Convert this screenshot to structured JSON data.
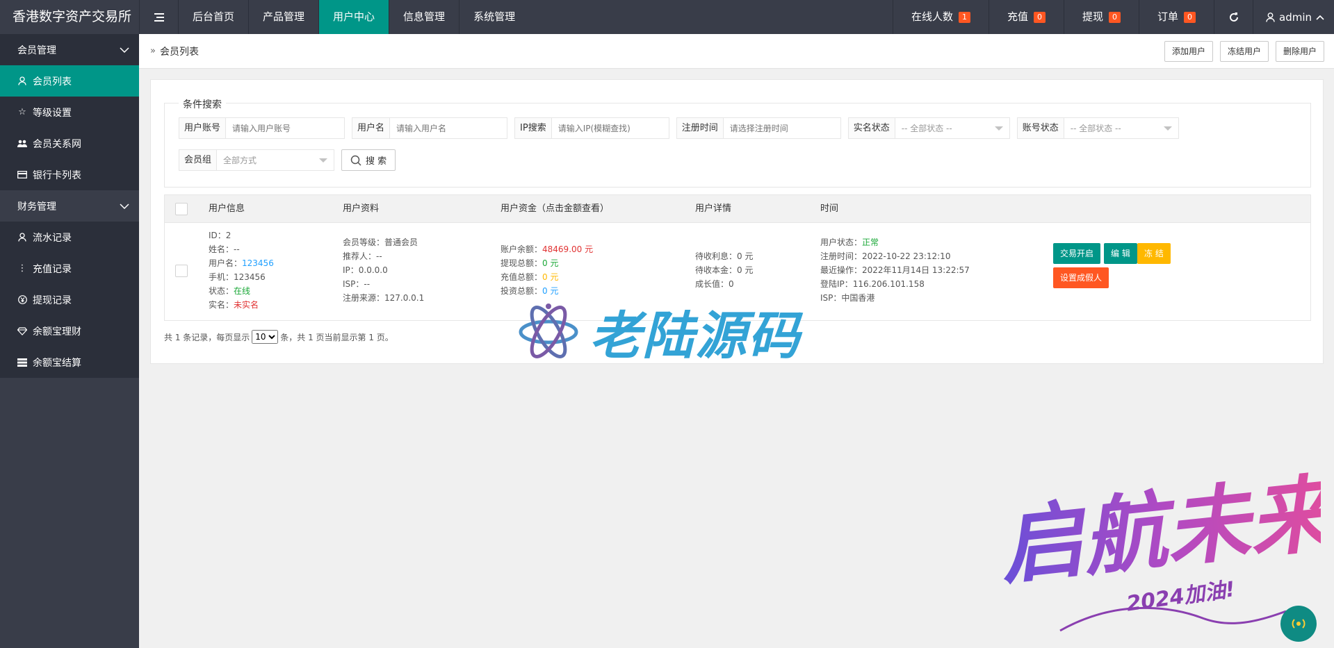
{
  "header": {
    "title": "香港数字资产交易所",
    "nav": [
      "后台首页",
      "产品管理",
      "用户中心",
      "信息管理",
      "系统管理"
    ],
    "active_nav": 2,
    "stats": [
      {
        "label": "在线人数",
        "count": "1"
      },
      {
        "label": "充值",
        "count": "0"
      },
      {
        "label": "提现",
        "count": "0"
      },
      {
        "label": "订单",
        "count": "0"
      }
    ],
    "user": "admin",
    "icons": {
      "toggle": "hamburger-icon",
      "refresh": "refresh-icon",
      "user": "user-icon",
      "caret": "chevron-up-icon"
    }
  },
  "sidebar": {
    "group1": "会员管理",
    "group1_items": [
      {
        "label": "会员列表",
        "icon": "user-icon"
      },
      {
        "label": "等级设置",
        "icon": "star-icon"
      },
      {
        "label": "会员关系网",
        "icon": "users-icon"
      },
      {
        "label": "银行卡列表",
        "icon": "card-icon"
      }
    ],
    "group2": "财务管理",
    "group2_items": [
      {
        "label": "流水记录",
        "icon": "user-icon"
      },
      {
        "label": "充值记录",
        "icon": "dots-icon"
      },
      {
        "label": "提现记录",
        "icon": "yen-icon"
      },
      {
        "label": "余额宝理财",
        "icon": "diamond-icon"
      },
      {
        "label": "余额宝结算",
        "icon": "server-icon"
      }
    ]
  },
  "breadcrumb": {
    "current": "会员列表",
    "buttons": [
      "添加用户",
      "冻结用户",
      "删除用户"
    ]
  },
  "search": {
    "legend": "条件搜索",
    "account_label": "用户账号",
    "account_placeholder": "请输入用户账号",
    "name_label": "用户名",
    "name_placeholder": "请输入用户名",
    "ip_label": "IP搜索",
    "ip_placeholder": "请输入IP(模糊查找)",
    "time_label": "注册时间",
    "time_placeholder": "请选择注册时间",
    "realname_label": "实名状态",
    "realname_value": "-- 全部状态 --",
    "status_label": "账号状态",
    "status_value": "-- 全部状态 --",
    "group_label": "会员组",
    "group_value": "全部方式",
    "button": "搜 索"
  },
  "table": {
    "headers": [
      "用户信息",
      "用户资料",
      "用户资金（点击金额查看）",
      "用户详情",
      "时间"
    ],
    "row": {
      "id": "ID：2",
      "surname": "姓名：--",
      "username_label": "用户名：",
      "username": "123456",
      "phone": "手机：123456",
      "status_label": "状态：",
      "status": "在线",
      "realname_label": "实名：",
      "realname": "未实名",
      "level": "会员等级：普通会员",
      "referrer": "推荐人：--",
      "ip": "IP：0.0.0.0",
      "isp": "ISP：--",
      "source": "注册来源：127.0.0.1",
      "balance_label": "账户余额：",
      "balance": "48469.00 元",
      "withdraw_label": "提现总额：",
      "withdraw": "0 元",
      "recharge_label": "充值总额：",
      "recharge": "0 元",
      "invest_label": "投资总额：",
      "invest": "0 元",
      "pending_interest": "待收利息：0 元",
      "pending_principal": "待收本金：0 元",
      "growth": "成长值：0",
      "user_status_label": "用户状态：",
      "user_status": "正常",
      "reg_time": "注册时间：2022-10-22 23:12:10",
      "last_op": "最近操作：2022年11月14日 13:22:57",
      "login_ip": "登陆IP：116.206.101.158",
      "isp2": "ISP：中国香港",
      "actions": [
        "交易开启",
        "编 辑",
        "冻 结",
        "设置成假人"
      ]
    }
  },
  "pager": {
    "prefix": "共 1 条记录，每页显示",
    "per_page": "10",
    "suffix": "条，共 1 页当前显示第 1 页。"
  },
  "watermark": {
    "brand": "老陆源码",
    "slogan": "启航未来",
    "sub": "2024加油!"
  },
  "colors": {
    "primary": "#009688",
    "dark": "#393d49",
    "warn": "#ffb800",
    "danger": "#ff5722"
  }
}
